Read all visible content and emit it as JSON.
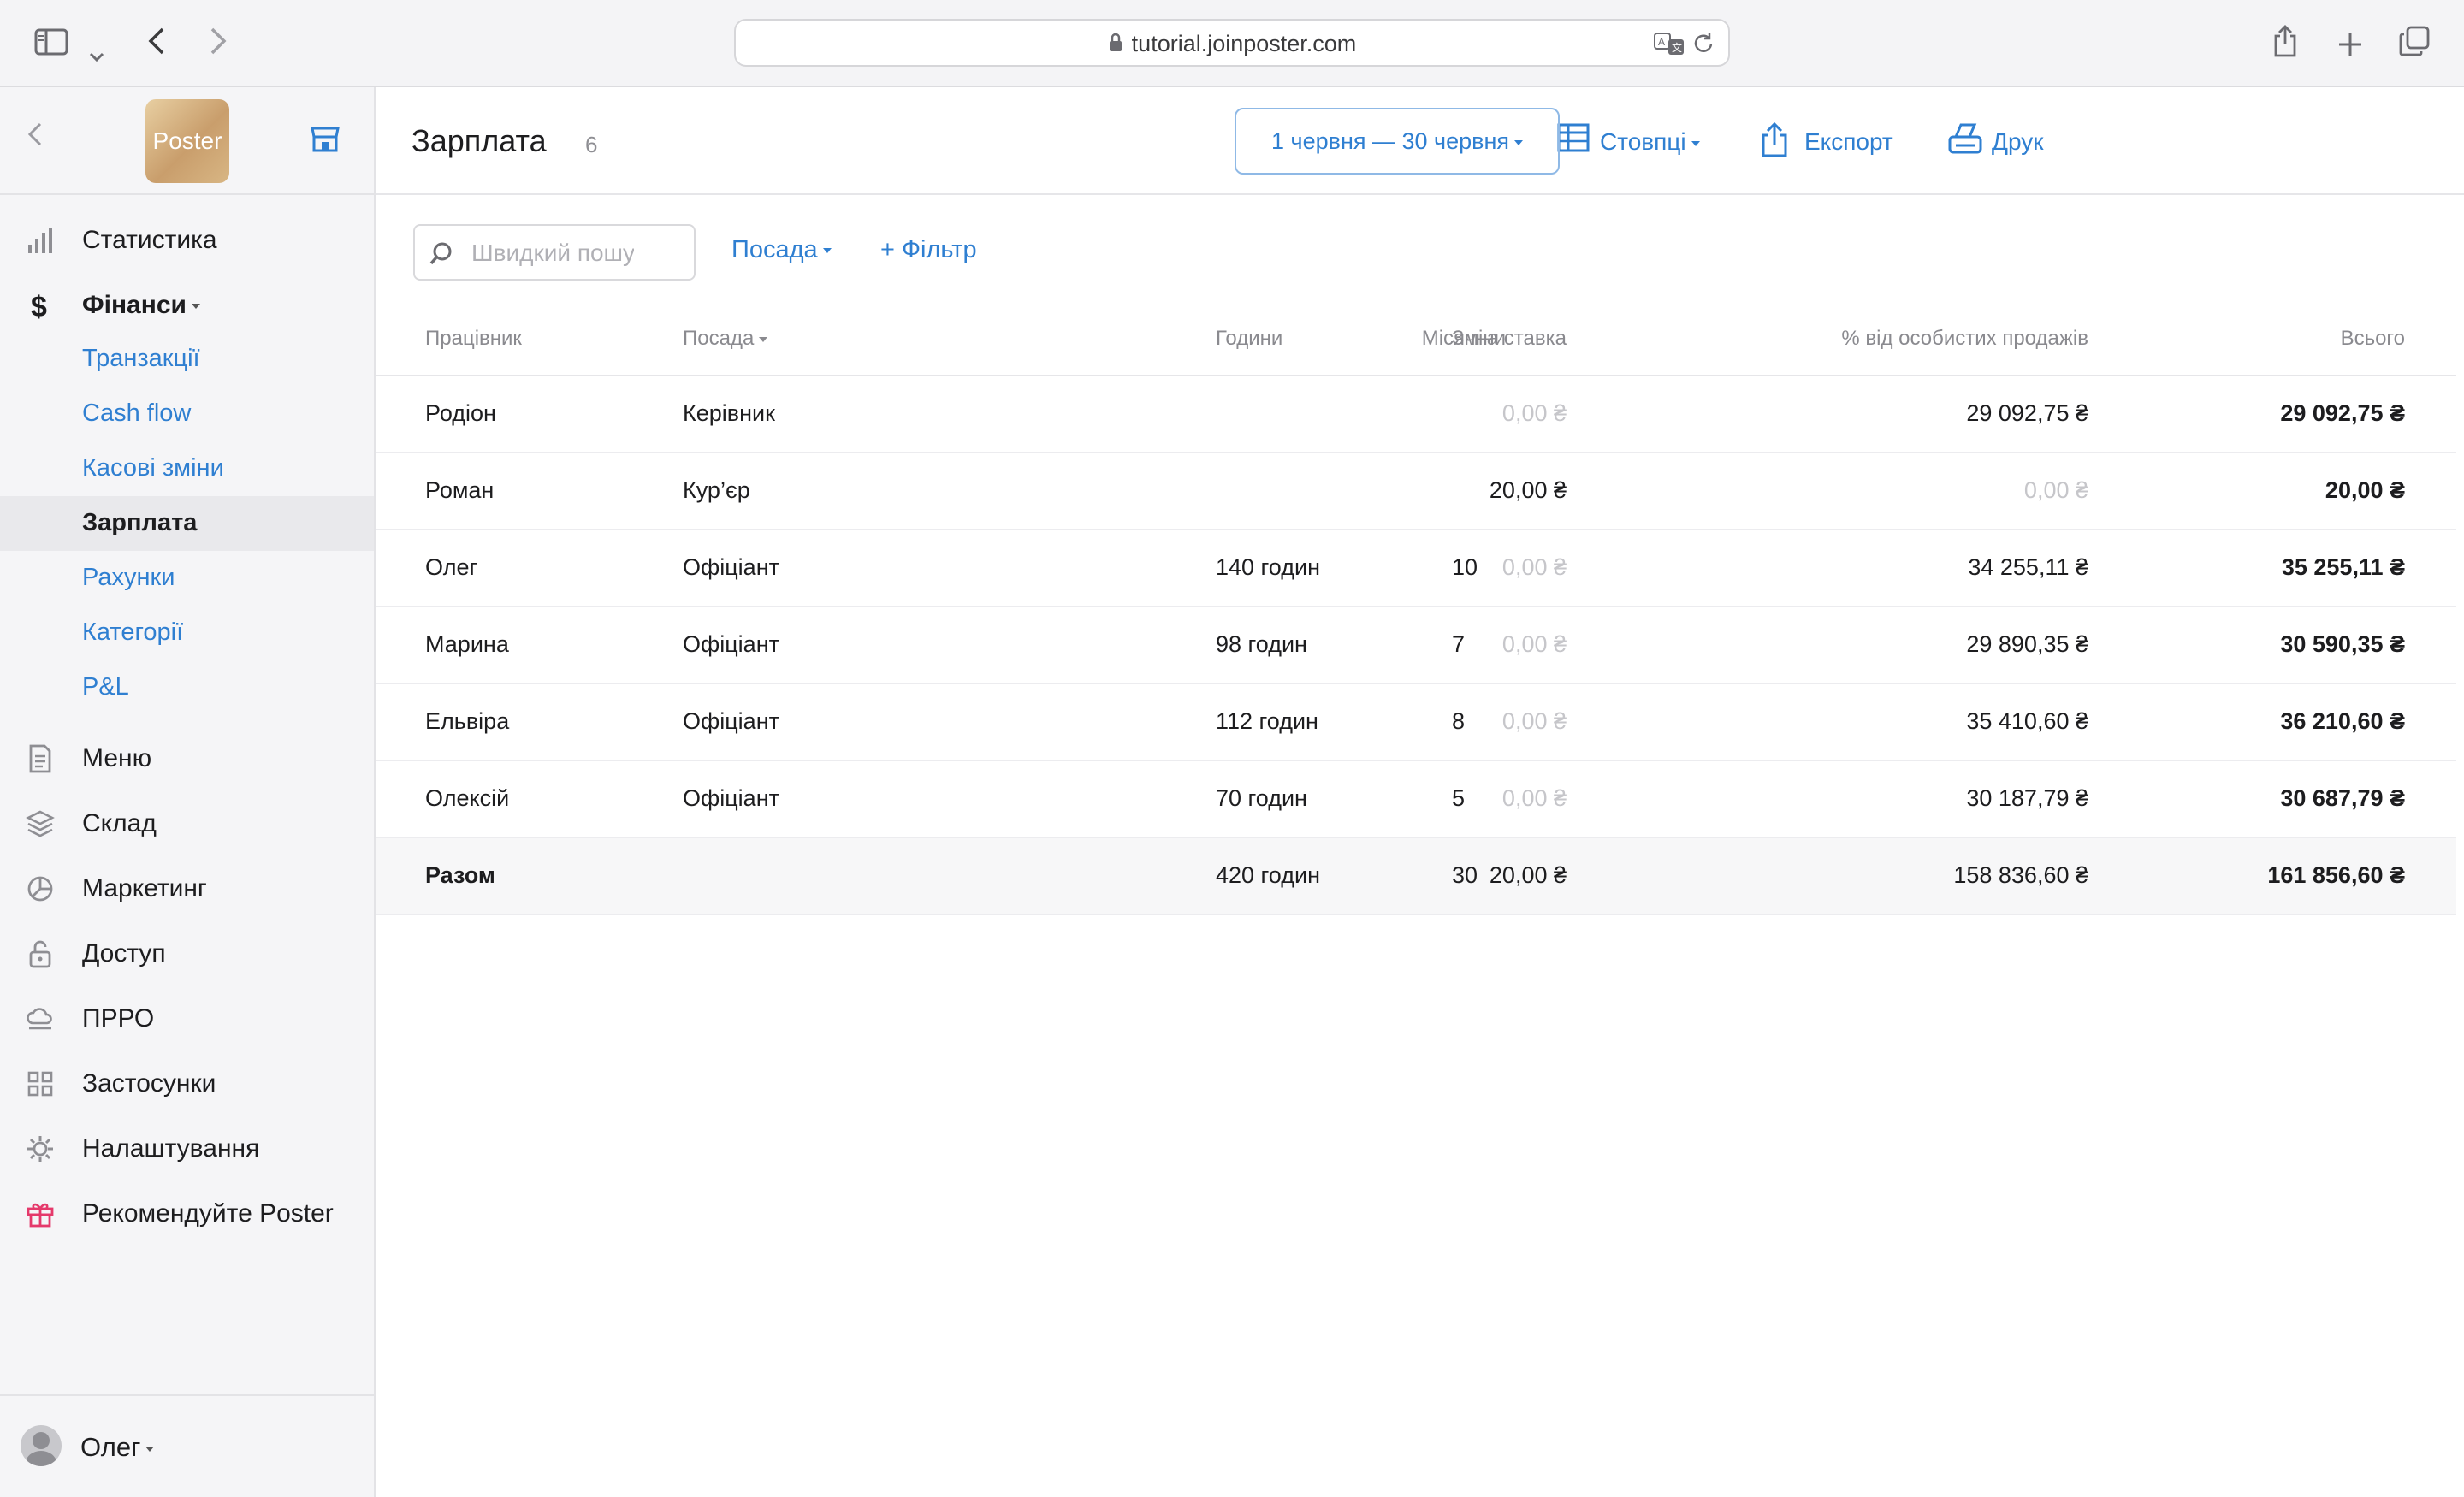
{
  "browser": {
    "url": "tutorial.joinposter.com"
  },
  "sidebar": {
    "logo_text": "Poster",
    "items": [
      {
        "label": "Статистика",
        "icon": "bar-chart-icon"
      },
      {
        "label": "Фінанси",
        "icon": "dollar-icon"
      },
      {
        "label": "Меню",
        "icon": "document-icon"
      },
      {
        "label": "Склад",
        "icon": "layers-icon"
      },
      {
        "label": "Маркетинг",
        "icon": "pie-icon"
      },
      {
        "label": "Доступ",
        "icon": "lock-icon"
      },
      {
        "label": "ПРРО",
        "icon": "cloud-icon"
      },
      {
        "label": "Застосунки",
        "icon": "grid-icon"
      },
      {
        "label": "Налаштування",
        "icon": "gear-icon"
      },
      {
        "label": "Рекомендуйте Poster",
        "icon": "gift-icon"
      }
    ],
    "finance_subitems": [
      {
        "label": "Транзакції"
      },
      {
        "label": "Cash flow"
      },
      {
        "label": "Касові зміни"
      },
      {
        "label": "Зарплата"
      },
      {
        "label": "Рахунки"
      },
      {
        "label": "Категорії"
      },
      {
        "label": "P&L"
      }
    ],
    "user": "Олег"
  },
  "header": {
    "title": "Зарплата",
    "count": "6",
    "columns_label": "Стовпці",
    "export_label": "Експорт",
    "print_label": "Друк",
    "date_range": "1 червня — 30 червня"
  },
  "filters": {
    "search_placeholder": "Швидкий пошук",
    "position_label": "Посада",
    "add_filter_label": "+ Фільтр"
  },
  "table": {
    "columns": [
      "Працівник",
      "Посада",
      "Місячна ставка",
      "Години",
      "Зміни",
      "% від особистих продажів",
      "Всього"
    ],
    "rows": [
      {
        "name": "Родіон",
        "position": "Керівник",
        "rate": "0,00 ₴",
        "hours": "",
        "shifts": "",
        "percent": "29 092,75 ₴",
        "total": "29 092,75 ₴"
      },
      {
        "name": "Роман",
        "position": "Кур’єр",
        "rate": "20,00 ₴",
        "hours": "",
        "shifts": "",
        "percent": "0,00 ₴",
        "total": "20,00 ₴"
      },
      {
        "name": "Олег",
        "position": "Офіціант",
        "rate": "0,00 ₴",
        "hours": "140 годин",
        "shifts": "10",
        "percent": "34 255,11 ₴",
        "total": "35 255,11 ₴"
      },
      {
        "name": "Марина",
        "position": "Офіціант",
        "rate": "0,00 ₴",
        "hours": "98 годин",
        "shifts": "7",
        "percent": "29 890,35 ₴",
        "total": "30 590,35 ₴"
      },
      {
        "name": "Ельвіра",
        "position": "Офіціант",
        "rate": "0,00 ₴",
        "hours": "112 годин",
        "shifts": "8",
        "percent": "35 410,60 ₴",
        "total": "36 210,60 ₴"
      },
      {
        "name": "Олексій",
        "position": "Офіціант",
        "rate": "0,00 ₴",
        "hours": "70 годин",
        "shifts": "5",
        "percent": "30 187,79 ₴",
        "total": "30 687,79 ₴"
      }
    ],
    "totals": {
      "label": "Разом",
      "rate": "20,00 ₴",
      "hours": "420 годин",
      "shifts": "30",
      "percent": "158 836,60 ₴",
      "total": "161 856,60 ₴"
    }
  },
  "colors": {
    "accent": "#2f7fd1",
    "muted": "#c6c6ca",
    "gift": "#e5396b"
  }
}
